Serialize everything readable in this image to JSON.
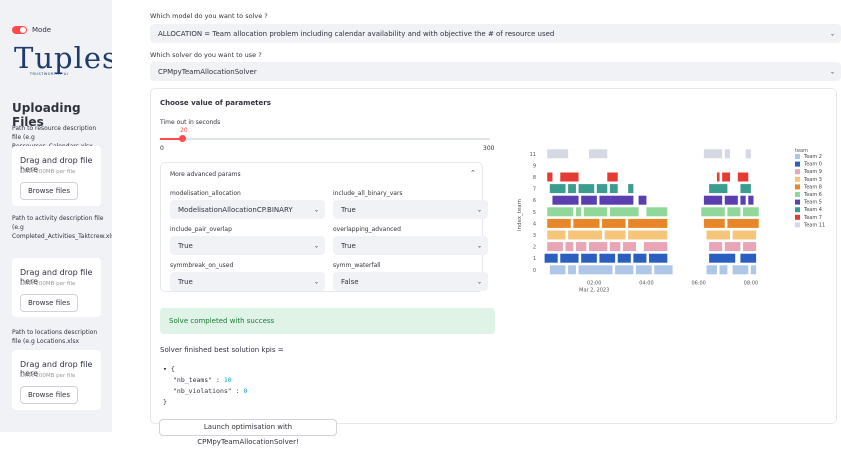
{
  "sidebar": {
    "mode_label": "Mode",
    "logo": {
      "word": "Tuples",
      "tagline": "TRUSTWORTHY AI"
    },
    "title": "Uploading Files",
    "uploads": [
      {
        "label": "Path to resource description file (e.g Ressources_Calendars.xlsx",
        "drop_text": "Drag and drop file here",
        "limit": "Limit 200MB per file",
        "button": "Browse files"
      },
      {
        "label": "Path to activity description file (e.g Completed_Activities_Taktcrew.xlsx)",
        "drop_text": "Drag and drop file here",
        "limit": "Limit 200MB per file",
        "button": "Browse files"
      },
      {
        "label": "Path to locations description file (e.g Locations.xlsx",
        "drop_text": "Drag and drop file here",
        "limit": "Limit 200MB per file",
        "button": "Browse files"
      }
    ]
  },
  "main": {
    "model_question": "Which model do you want to solve ?",
    "model_value": "ALLOCATION = Team allocation problem including calendar availability and with objective the # of resource used",
    "solver_question": "Which solver do you want to use ?",
    "solver_value": "CPMpyTeamAllocationSolver",
    "params_title": "Choose value of parameters",
    "timeout_label": "Time out in seconds",
    "timeout_value": "20",
    "timeout_fraction": 0.0667,
    "timeout_min": "0",
    "timeout_max": "300",
    "advanced_title": "More advanced params",
    "advanced": [
      {
        "label": "modelisation_allocation",
        "value": "ModelisationAllocationCP.BINARY"
      },
      {
        "label": "include_all_binary_vars",
        "value": "True"
      },
      {
        "label": "include_pair_overlap",
        "value": "True"
      },
      {
        "label": "overlapping_advanced",
        "value": "True"
      },
      {
        "label": "symmbreak_on_used",
        "value": "True"
      },
      {
        "label": "symm_waterfall",
        "value": "False"
      }
    ],
    "success_text": "Solve completed with success",
    "kpis_label": "Solver finished best solution kpis =",
    "kpis": [
      {
        "key": "\"nb_teams\"",
        "value": "10"
      },
      {
        "key": "\"nb_violations\"",
        "value": "0"
      }
    ],
    "launch_button": "Launch optimisation with CPMpyTeamAllocationSolver!"
  },
  "chart_data": {
    "type": "gantt",
    "ylabel": "index_team",
    "y_ticks": [
      "0",
      "1",
      "2",
      "3",
      "4",
      "5",
      "6",
      "7",
      "8",
      "9",
      "11"
    ],
    "x_ticks": [
      "02:00",
      "04:00",
      "06:00",
      "08:00"
    ],
    "x_sublabel": "Mar 2, 2023",
    "x_range_hours": [
      0,
      9
    ],
    "legend_title": "team",
    "series": [
      {
        "name": "Team 2",
        "row": 0,
        "color": "#aec7e8"
      },
      {
        "name": "Team 0",
        "row": 1,
        "color": "#2a5fbf"
      },
      {
        "name": "Team 9",
        "row": 2,
        "color": "#e8a5b5"
      },
      {
        "name": "Team 3",
        "row": 3,
        "color": "#f5c67a"
      },
      {
        "name": "Team 8",
        "row": 4,
        "color": "#e8862a"
      },
      {
        "name": "Team 6",
        "row": 5,
        "color": "#8fd89a"
      },
      {
        "name": "Team 5",
        "row": 6,
        "color": "#5b3fb0"
      },
      {
        "name": "Team 4",
        "row": 7,
        "color": "#3a9d8f"
      },
      {
        "name": "Team 7",
        "row": 8,
        "color": "#e53b32"
      },
      {
        "name": "Team 11",
        "row": 9,
        "color": "#d5d9e3"
      }
    ],
    "row_index": [
      "0",
      "1",
      "2",
      "3",
      "4",
      "5",
      "6",
      "7",
      "8",
      "9",
      "11"
    ],
    "tasks": [
      [
        0,
        [
          [
            0.3,
            0.9
          ],
          [
            1.0,
            1.3
          ],
          [
            1.4,
            2.7
          ],
          [
            2.8,
            3.5
          ],
          [
            3.6,
            4.2
          ],
          [
            4.3,
            5.0
          ],
          [
            6.3,
            6.7
          ],
          [
            6.8,
            7.1
          ],
          [
            7.3,
            7.9
          ],
          [
            8.0,
            8.2
          ]
        ]
      ],
      [
        1,
        [
          [
            0.1,
            0.6
          ],
          [
            0.7,
            1.4
          ],
          [
            1.5,
            2.1
          ],
          [
            2.2,
            2.8
          ],
          [
            2.9,
            3.4
          ],
          [
            3.5,
            4.0
          ],
          [
            4.1,
            4.8
          ],
          [
            6.4,
            7.4
          ],
          [
            7.6,
            8.2
          ]
        ]
      ],
      [
        2,
        [
          [
            0.2,
            0.8
          ],
          [
            0.9,
            1.2
          ],
          [
            1.3,
            1.7
          ],
          [
            1.8,
            2.5
          ],
          [
            2.6,
            3.0
          ],
          [
            3.1,
            3.6
          ],
          [
            3.9,
            4.8
          ],
          [
            6.4,
            6.9
          ],
          [
            7.0,
            7.6
          ],
          [
            7.7,
            8.2
          ]
        ]
      ],
      [
        3,
        [
          [
            0.2,
            0.9
          ],
          [
            1.0,
            2.3
          ],
          [
            2.4,
            3.2
          ],
          [
            3.3,
            4.8
          ],
          [
            6.3,
            7.2
          ],
          [
            7.3,
            8.2
          ]
        ]
      ],
      [
        4,
        [
          [
            0.2,
            1.1
          ],
          [
            1.2,
            2.2
          ],
          [
            2.3,
            3.2
          ],
          [
            3.3,
            4.8
          ],
          [
            6.2,
            7.0
          ],
          [
            7.1,
            8.3
          ]
        ]
      ],
      [
        5,
        [
          [
            0.2,
            1.2
          ],
          [
            1.3,
            1.5
          ],
          [
            1.6,
            2.5
          ],
          [
            2.6,
            3.7
          ],
          [
            4.0,
            4.8
          ],
          [
            6.1,
            7.0
          ],
          [
            7.1,
            7.6
          ],
          [
            7.7,
            8.3
          ]
        ]
      ],
      [
        6,
        [
          [
            0.4,
            1.4
          ],
          [
            1.5,
            2.1
          ],
          [
            2.2,
            3.5
          ],
          [
            3.7,
            4.0
          ],
          [
            6.2,
            6.9
          ],
          [
            7.0,
            7.5
          ],
          [
            7.6,
            7.8
          ],
          [
            7.9,
            8.1
          ]
        ]
      ],
      [
        7,
        [
          [
            0.3,
            0.9
          ],
          [
            1.0,
            1.3
          ],
          [
            1.4,
            2.0
          ],
          [
            2.1,
            2.5
          ],
          [
            2.6,
            2.9
          ],
          [
            3.3,
            3.5
          ],
          [
            6.4,
            7.1
          ],
          [
            7.6,
            8.0
          ]
        ]
      ],
      [
        8,
        [
          [
            0.2,
            0.4
          ],
          [
            0.7,
            1.4
          ],
          [
            2.5,
            2.9
          ],
          [
            6.7,
            6.8
          ],
          [
            6.9,
            7.2
          ],
          [
            7.5,
            7.9
          ]
        ]
      ],
      [
        10,
        [
          [
            0.2,
            1.0
          ],
          [
            1.8,
            2.5
          ],
          [
            6.2,
            6.9
          ],
          [
            7.0,
            7.2
          ],
          [
            7.8,
            8.0
          ]
        ]
      ]
    ]
  },
  "colors": {
    "accent": "#ff4b4b",
    "sidebar_bg": "#f0f2f6",
    "success_bg": "#dff3e6"
  }
}
